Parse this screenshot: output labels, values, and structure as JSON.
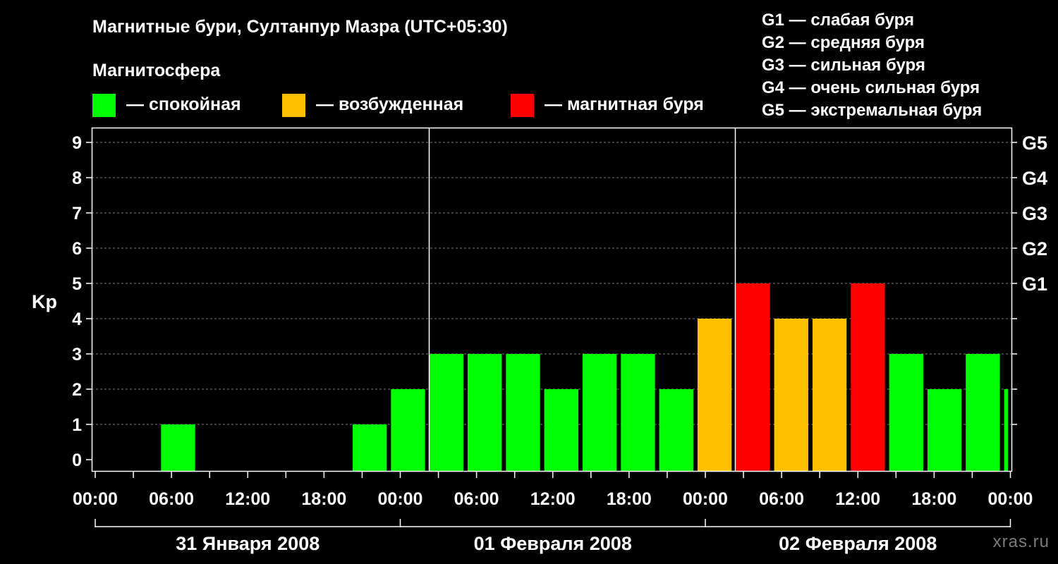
{
  "title": "Магнитные бури, Султанпур Мазра (UTC+05:30)",
  "magnetosphere_label": "Магнитосфера",
  "legend": [
    {
      "label": "— спокойная",
      "color": "#00ff00"
    },
    {
      "label": "— возбужденная",
      "color": "#ffc000"
    },
    {
      "label": "— магнитная буря",
      "color": "#ff0000"
    }
  ],
  "g_scale": [
    "G1 — слабая буря",
    "G2 — средняя буря",
    "G3 — сильная буря",
    "G4 — очень сильная буря",
    "G5 — экстремальная буря"
  ],
  "watermark": "xras.ru",
  "chart_data": {
    "type": "bar",
    "ylabel": "Kp",
    "ylim": [
      0,
      9
    ],
    "yticks": [
      0,
      1,
      2,
      3,
      4,
      5,
      6,
      7,
      8,
      9
    ],
    "right_axis_labels": [
      {
        "kp": 5,
        "label": "G1"
      },
      {
        "kp": 6,
        "label": "G2"
      },
      {
        "kp": 7,
        "label": "G3"
      },
      {
        "kp": 8,
        "label": "G4"
      },
      {
        "kp": 9,
        "label": "G5"
      }
    ],
    "x_tick_labels": [
      "00:00",
      "06:00",
      "12:00",
      "18:00",
      "00:00",
      "06:00",
      "12:00",
      "18:00",
      "00:00",
      "06:00",
      "12:00",
      "18:00",
      "00:00"
    ],
    "days": [
      "31 Января 2008",
      "01 Февраля 2008",
      "02 Февраля 2008"
    ],
    "grid": true,
    "colors": {
      "quiet": "#00ff00",
      "active": "#ffc000",
      "storm": "#ff0000"
    },
    "bars": [
      {
        "time": "31 Января 2008 00:00",
        "kp": 0,
        "level": "quiet"
      },
      {
        "time": "31 Января 2008 03:00",
        "kp": 1,
        "level": "quiet"
      },
      {
        "time": "31 Января 2008 06:00",
        "kp": 0,
        "level": "quiet"
      },
      {
        "time": "31 Января 2008 09:00",
        "kp": 0,
        "level": "quiet"
      },
      {
        "time": "31 Января 2008 12:00",
        "kp": 0,
        "level": "quiet"
      },
      {
        "time": "31 Января 2008 15:00",
        "kp": 0,
        "level": "quiet"
      },
      {
        "time": "31 Января 2008 18:00",
        "kp": 1,
        "level": "quiet"
      },
      {
        "time": "31 Января 2008 21:00",
        "kp": 2,
        "level": "quiet"
      },
      {
        "time": "01 Февраля 2008 00:00",
        "kp": 3,
        "level": "quiet"
      },
      {
        "time": "01 Февраля 2008 03:00",
        "kp": 3,
        "level": "quiet"
      },
      {
        "time": "01 Февраля 2008 06:00",
        "kp": 3,
        "level": "quiet"
      },
      {
        "time": "01 Февраля 2008 09:00",
        "kp": 2,
        "level": "quiet"
      },
      {
        "time": "01 Февраля 2008 12:00",
        "kp": 3,
        "level": "quiet"
      },
      {
        "time": "01 Февраля 2008 15:00",
        "kp": 3,
        "level": "quiet"
      },
      {
        "time": "01 Февраля 2008 18:00",
        "kp": 2,
        "level": "quiet"
      },
      {
        "time": "01 Февраля 2008 21:00",
        "kp": 4,
        "level": "active"
      },
      {
        "time": "02 Февраля 2008 00:00",
        "kp": 5,
        "level": "storm"
      },
      {
        "time": "02 Февраля 2008 03:00",
        "kp": 4,
        "level": "active"
      },
      {
        "time": "02 Февраля 2008 06:00",
        "kp": 4,
        "level": "active"
      },
      {
        "time": "02 Февраля 2008 09:00",
        "kp": 5,
        "level": "storm"
      },
      {
        "time": "02 Февраля 2008 12:00",
        "kp": 3,
        "level": "quiet"
      },
      {
        "time": "02 Февраля 2008 15:00",
        "kp": 2,
        "level": "quiet"
      },
      {
        "time": "02 Февраля 2008 18:00",
        "kp": 3,
        "level": "quiet"
      },
      {
        "time": "02 Февраля 2008 21:00",
        "kp": 2,
        "level": "quiet"
      },
      {
        "time": "03 Февраля 2008 00:00",
        "kp": 3,
        "level": "quiet"
      }
    ]
  }
}
